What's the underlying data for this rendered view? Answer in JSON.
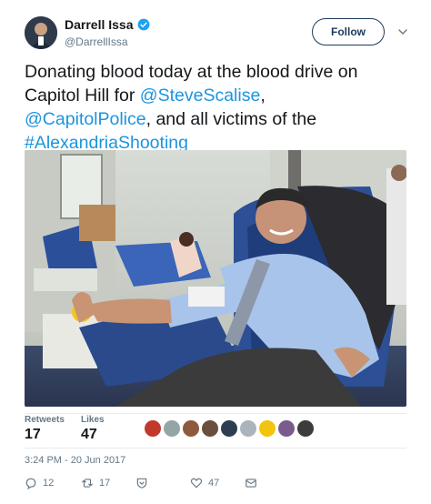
{
  "author": {
    "name": "Darrell Issa",
    "handle": "@DarrellIssa"
  },
  "follow_label": "Follow",
  "tweet": {
    "text_intro": "Donating blood today at the blood drive on Capitol Hill for ",
    "mention_1": "@SteveScalise",
    "text_sep": ", ",
    "mention_2": "@CapitolPolice",
    "text_mid": ", and all victims of the ",
    "hashtag": "#AlexandriaShooting"
  },
  "stats": {
    "retweets_label": "Retweets",
    "retweets_value": "17",
    "likes_label": "Likes",
    "likes_value": "47",
    "liker_colors": [
      "#c0392b",
      "#95a5a6",
      "#8e5a3c",
      "#6b4e3d",
      "#2c3e50",
      "#a9b4bd",
      "#f1c40f",
      "#7a5c8c",
      "#3c3c3c"
    ]
  },
  "timestamp": "3:24 PM - 20 Jun 2017",
  "actions": {
    "reply_count": "12",
    "retweet_count": "17",
    "like_count": "47"
  },
  "colors": {
    "link": "#1b95e0",
    "verified": "#1da1f2",
    "muted": "#657786"
  }
}
